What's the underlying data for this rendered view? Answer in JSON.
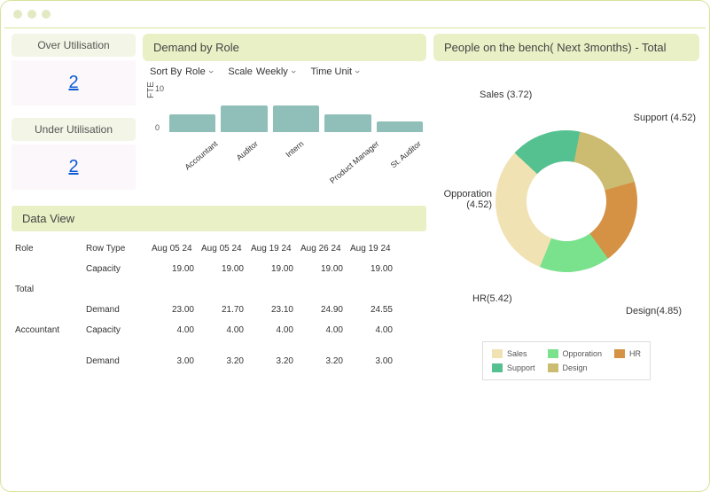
{
  "left": {
    "over_util_label": "Over Utilisation",
    "over_util_value": "2",
    "under_util_label": "Under Utilisation",
    "under_util_value": "2"
  },
  "demand": {
    "title": "Demand by Role",
    "sort_label": "Sort By",
    "sort_value": "Role",
    "scale_label": "Scale",
    "scale_value": "Weekly",
    "time_unit_label": "Time Unit",
    "fte_label": "FTE",
    "ytick_top": "10",
    "ytick_bot": "0"
  },
  "dataview": {
    "title": "Data View",
    "th_role": "Role",
    "th_rowtype": "Row Type",
    "dates": [
      "Aug 05 24",
      "Aug 05 24",
      "Aug 19 24",
      "Aug 26 24",
      "Aug 19 24"
    ],
    "role_total": "Total",
    "role_accountant": "Accountant",
    "rt_capacity": "Capacity",
    "rt_demand": "Demand",
    "total_cap": [
      "19.00",
      "19.00",
      "19.00",
      "19.00",
      "19.00"
    ],
    "total_dem": [
      "23.00",
      "21.70",
      "23.10",
      "24.90",
      "24.55"
    ],
    "acc_cap": [
      "4.00",
      "4.00",
      "4.00",
      "4.00",
      "4.00"
    ],
    "acc_dem": [
      "3.00",
      "3.20",
      "3.20",
      "3.20",
      "3.00"
    ]
  },
  "bench": {
    "title": "People on the bench( Next 3months) - Total",
    "labels": {
      "sales": "Sales (3.72)",
      "support": "Support (4.52)",
      "opporation": "Opporation (4.52)",
      "hr": "HR(5.42)",
      "design": "Design(4.85)"
    },
    "legend": {
      "sales": "Sales",
      "opporation": "Opporation",
      "hr": "HR",
      "support": "Support",
      "design": "Design"
    }
  },
  "chart_data": [
    {
      "type": "bar",
      "title": "Demand by Role",
      "ylabel": "FTE",
      "ylim": [
        0,
        10
      ],
      "categories": [
        "Accountant",
        "Auditor",
        "Intern",
        "Product Manager",
        "St. Auditor"
      ],
      "values": [
        4,
        6,
        6,
        4,
        2.5
      ]
    },
    {
      "type": "pie",
      "title": "People on the bench( Next 3months) - Total",
      "series": [
        {
          "name": "Sales",
          "value": 3.72,
          "color": "#f1e2b4"
        },
        {
          "name": "Support",
          "value": 4.52,
          "color": "#55c190"
        },
        {
          "name": "Design",
          "value": 4.85,
          "color": "#ccbc72"
        },
        {
          "name": "HR",
          "value": 5.42,
          "color": "#d59245"
        },
        {
          "name": "Opporation",
          "value": 4.52,
          "color": "#7ae18d"
        }
      ]
    },
    {
      "type": "table",
      "title": "Data View",
      "columns": [
        "Role",
        "Row Type",
        "Aug 05 24",
        "Aug 05 24",
        "Aug 19 24",
        "Aug 26 24",
        "Aug 19 24"
      ],
      "rows": [
        [
          "Total",
          "Capacity",
          19.0,
          19.0,
          19.0,
          19.0,
          19.0
        ],
        [
          "Total",
          "Demand",
          23.0,
          21.7,
          23.1,
          24.9,
          24.55
        ],
        [
          "Accountant",
          "Capacity",
          4.0,
          4.0,
          4.0,
          4.0,
          4.0
        ],
        [
          "Accountant",
          "Demand",
          3.0,
          3.2,
          3.2,
          3.2,
          3.0
        ]
      ]
    }
  ]
}
